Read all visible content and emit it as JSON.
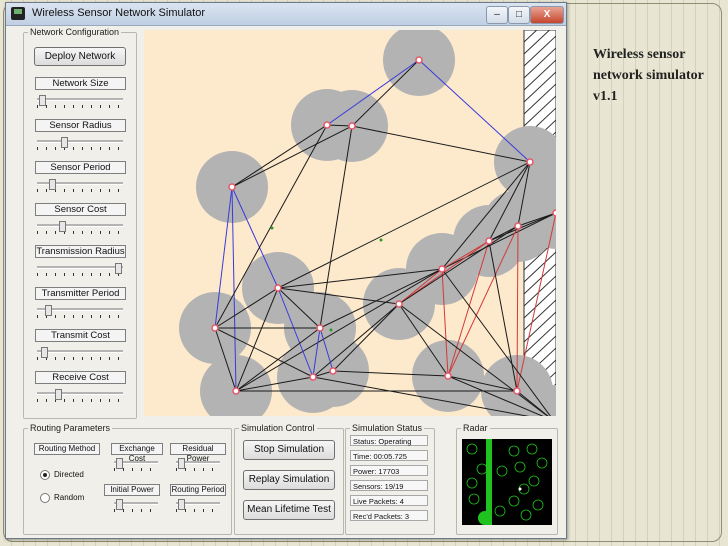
{
  "slide": {
    "title": "Wireless sensor network simulator v1.1"
  },
  "window": {
    "title": "Wireless Sensor Network Simulator",
    "min": "–",
    "max": "□",
    "close": "X"
  },
  "config": {
    "legend": "Network Configuration",
    "deploy": "Deploy Network",
    "sliders": [
      {
        "label": "Network Size",
        "value": 0.02
      },
      {
        "label": "Sensor Radius",
        "value": 0.3
      },
      {
        "label": "Sensor Period",
        "value": 0.15
      },
      {
        "label": "Sensor Cost",
        "value": 0.28
      },
      {
        "label": "Transmission Radius",
        "value": 0.98
      },
      {
        "label": "Transmitter Period",
        "value": 0.1
      },
      {
        "label": "Transmit Cost",
        "value": 0.05
      },
      {
        "label": "Receive Cost",
        "value": 0.22
      }
    ]
  },
  "routing": {
    "legend": "Routing Parameters",
    "method_label": "Routing Method",
    "exchange_cost": "Exchange Cost",
    "residual_power": "Residual Power",
    "initial_power": "Initial Power",
    "routing_period": "Routing Period",
    "directed": "Directed",
    "random": "Random",
    "selected": "Directed"
  },
  "control": {
    "legend": "Simulation Control",
    "stop": "Stop Simulation",
    "replay": "Replay Simulation",
    "mean": "Mean Lifetime Test"
  },
  "status": {
    "legend": "Simulation Status",
    "rows": [
      "Status: Operating",
      "Time: 00:05.725",
      "Power: 17703",
      "Sensors: 19/19",
      "Live Packets: 4",
      "Rec'd Packets: 3"
    ]
  },
  "radar": {
    "legend": "Radar"
  },
  "colors": {
    "field": "#fde9cc",
    "coverage": "#b3b3b3",
    "node": "#e5586a",
    "blue": "#3a3adc",
    "red": "#d23a3a",
    "radar_bg": "#000000",
    "radar_green": "#1fc21f"
  }
}
